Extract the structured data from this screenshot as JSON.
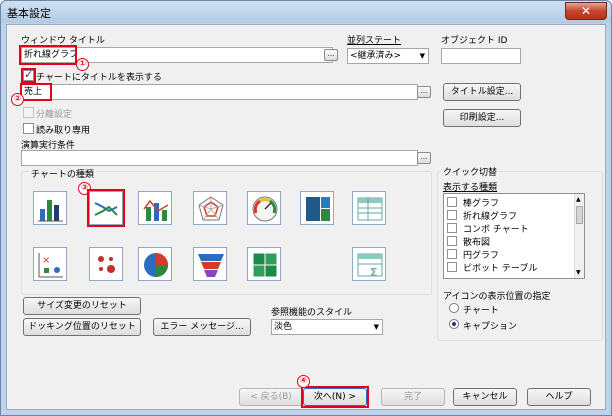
{
  "window": {
    "title": "基本設定",
    "close_glyph": "✕"
  },
  "window_title_field": {
    "label": "ウィンドウ タイトル",
    "value": "折れ線グラフ",
    "browse": "..."
  },
  "sort_state": {
    "label": "並列ステート",
    "value": "<継承済み>",
    "caret": "▼"
  },
  "object_id": {
    "label": "オブジェクト ID",
    "value": ""
  },
  "show_title_checkbox": {
    "label": "チャートにタイトルを表示する",
    "checked": true
  },
  "title_field": {
    "value": "売上",
    "browse": "..."
  },
  "title_settings_button": "タイトル設定...",
  "detach_checkbox": {
    "label": "分離設定"
  },
  "readonly_checkbox": {
    "label": "読み取り専用"
  },
  "print_settings_button": "印刷設定...",
  "calc_condition": {
    "label": "演算実行条件",
    "value": "",
    "browse": "..."
  },
  "chart_types": {
    "label": "チャートの種類",
    "items": [
      "棒グラフ",
      "折れ線グラフ",
      "コンボ チャート",
      "レーダーチャート",
      "ゲージ",
      "ブロックチャート",
      "ストレートテーブル",
      "散布図",
      "グリッドチャート",
      "円グラフ",
      "ファネルチャート",
      "メッケチャート",
      "ピボットテーブル"
    ]
  },
  "quick_switch": {
    "group_label": "クイック切替",
    "list_label": "表示する種類",
    "items": [
      "棒グラフ",
      "折れ線グラフ",
      "コンボ チャート",
      "散布図",
      "円グラフ",
      "ピボット テーブル"
    ]
  },
  "icon_position": {
    "label": "アイコンの表示位置の指定",
    "options": [
      "チャート",
      "キャプション"
    ],
    "selected": "キャプション"
  },
  "reference_style": {
    "label": "参照機能のスタイル",
    "value": "淡色",
    "caret": "▼"
  },
  "buttons": {
    "size_reset": "サイズ変更のリセット",
    "docking_reset": "ドッキング位置のリセット",
    "error_message": "エラー メッセージ...",
    "back": "< 戻る(B)",
    "next": "次へ(N) >",
    "finish": "完了",
    "cancel": "キャンセル",
    "help": "ヘルプ"
  },
  "markers": [
    "①",
    "②",
    "③",
    "④"
  ],
  "colors": {
    "highlight": "#e0001b",
    "accent": "#1a3f86"
  }
}
